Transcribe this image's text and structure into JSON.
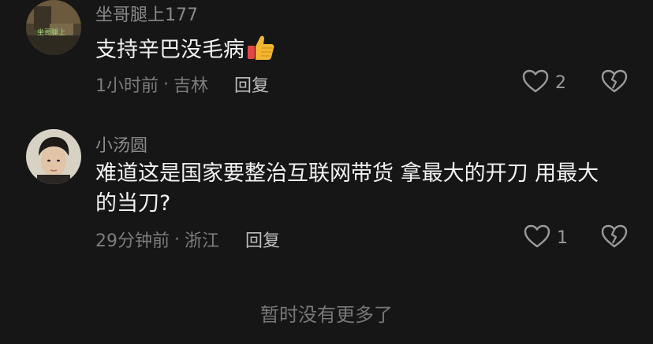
{
  "comments": [
    {
      "username": "坐哥腿上177",
      "text": "支持辛巴没毛病",
      "emoji_icon": "thumbs-up-icon",
      "time": "1小时前",
      "separator": "·",
      "location": "吉林",
      "reply_label": "回复",
      "likes": "2"
    },
    {
      "username": "小汤圆",
      "text": "难道这是国家要整治互联网带货 拿最大的开刀 用最大的当刀?",
      "time": "29分钟前",
      "separator": "·",
      "location": "浙江",
      "reply_label": "回复",
      "likes": "1"
    }
  ],
  "footer": {
    "end_text": "暂时没有更多了"
  },
  "colors": {
    "background": "#161616",
    "username": "#8a8a8a",
    "text": "#f2f2f2",
    "meta": "#7c7c7c"
  }
}
